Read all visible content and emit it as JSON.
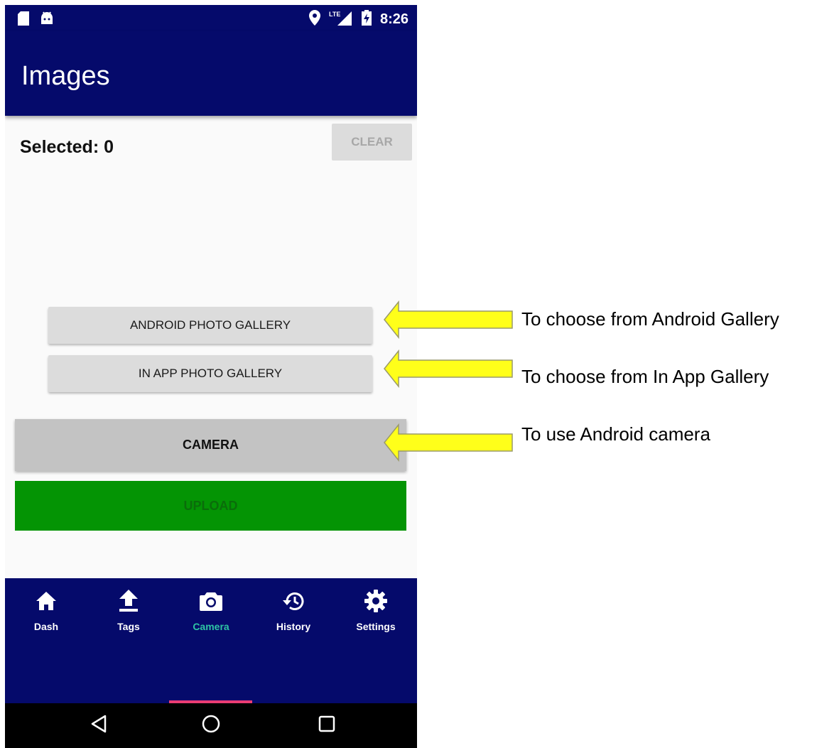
{
  "status_bar": {
    "time": "8:26",
    "icons": [
      "sd-card-icon",
      "android-icon",
      "location-pin-icon",
      "lte-signal-icon",
      "battery-charging-icon"
    ],
    "network_label": "LTE"
  },
  "app_bar": {
    "title": "Images"
  },
  "selection": {
    "label": "Selected: 0",
    "clear_label": "CLEAR"
  },
  "buttons": {
    "android_gallery": "ANDROID PHOTO GALLERY",
    "in_app_gallery": "IN APP PHOTO GALLERY",
    "camera": "CAMERA",
    "upload": "UPLOAD"
  },
  "bottom_nav": {
    "items": [
      {
        "label": "Dash",
        "icon": "home-icon"
      },
      {
        "label": "Tags",
        "icon": "upload-icon"
      },
      {
        "label": "Camera",
        "icon": "camera-icon",
        "active": true
      },
      {
        "label": "History",
        "icon": "history-icon"
      },
      {
        "label": "Settings",
        "icon": "gear-icon"
      }
    ]
  },
  "system_nav": {
    "icons": [
      "back-icon",
      "home-circle-icon",
      "recents-icon"
    ]
  },
  "annotations": [
    {
      "text": "To choose from Android Gallery",
      "target": "android_gallery"
    },
    {
      "text": "To choose from In App Gallery",
      "target": "in_app_gallery"
    },
    {
      "text": "To use Android camera",
      "target": "camera"
    }
  ],
  "colors": {
    "primary": "#050a6b",
    "upload_green": "#049404",
    "active_tab": "#2ec4a4",
    "tab_indicator": "#ea3c73",
    "annotation_arrow": "#ffff1a"
  }
}
